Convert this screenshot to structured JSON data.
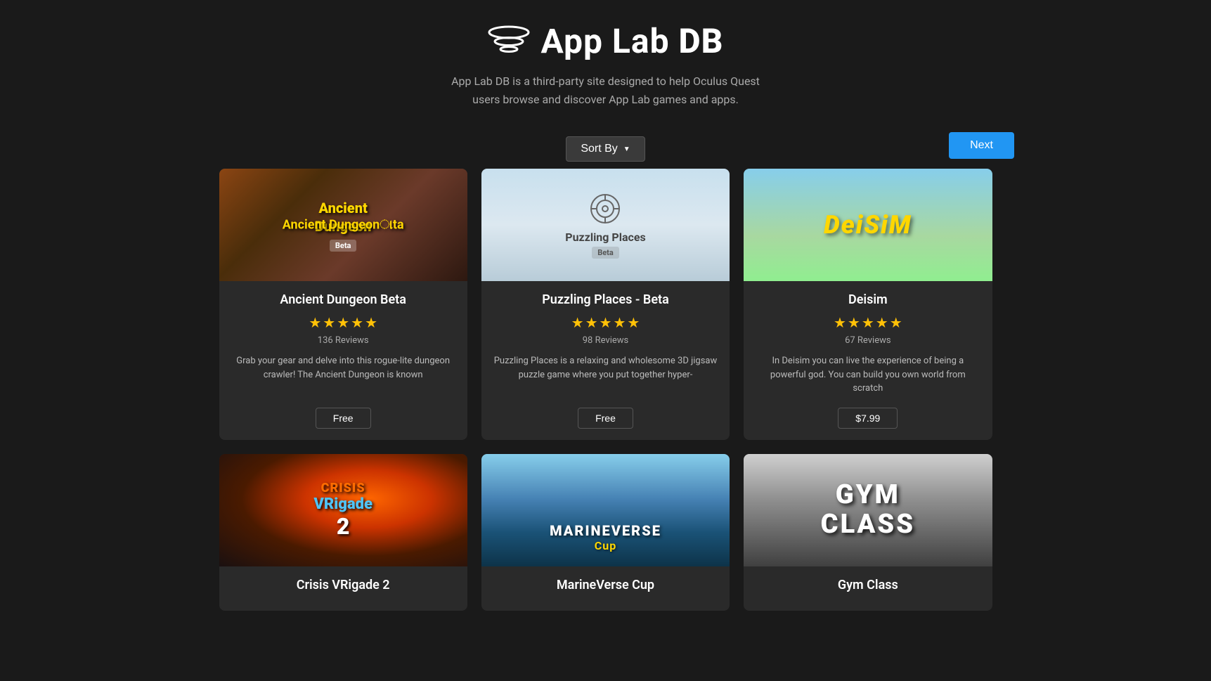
{
  "header": {
    "logo_text_light": "App Lab ",
    "logo_text_bold": "DB",
    "subtitle_line1": "App Lab DB is a third-party site designed to help Oculus Quest",
    "subtitle_line2": "users browse and discover App Lab games and apps."
  },
  "controls": {
    "sort_by_label": "Sort By",
    "next_label": "Next"
  },
  "cards": [
    {
      "id": "ancient-dungeon",
      "title": "Ancient Dungeon Beta",
      "stars": 5,
      "reviews": "136 Reviews",
      "description": "Grab your gear and delve into this rogue-lite dungeon crawler! The Ancient Dungeon is known",
      "price": "Free",
      "image_theme": "ancient"
    },
    {
      "id": "puzzling-places",
      "title": "Puzzling Places - Beta",
      "stars": 5,
      "reviews": "98 Reviews",
      "description": "Puzzling Places is a relaxing and wholesome 3D jigsaw puzzle game where you put together hyper-",
      "price": "Free",
      "image_theme": "puzzling"
    },
    {
      "id": "deisim",
      "title": "Deisim",
      "stars": 5,
      "reviews": "67 Reviews",
      "description": "In Deisim you can live the experience of being a powerful god. You can build you own world from scratch",
      "price": "$7.99",
      "image_theme": "deisim"
    },
    {
      "id": "crisis-vrigade-2",
      "title": "Crisis VRigade 2",
      "stars": 0,
      "reviews": "",
      "description": "",
      "price": "",
      "image_theme": "crisis"
    },
    {
      "id": "marineverse-cup",
      "title": "MarineVerse Cup",
      "stars": 0,
      "reviews": "",
      "description": "",
      "price": "",
      "image_theme": "marine"
    },
    {
      "id": "gym-class",
      "title": "Gym Class",
      "stars": 0,
      "reviews": "",
      "description": "",
      "price": "",
      "image_theme": "gym"
    }
  ],
  "colors": {
    "accent_blue": "#2196F3",
    "star_color": "#FFC107",
    "background": "#1a1a1a",
    "card_bg": "#2a2a2a"
  }
}
